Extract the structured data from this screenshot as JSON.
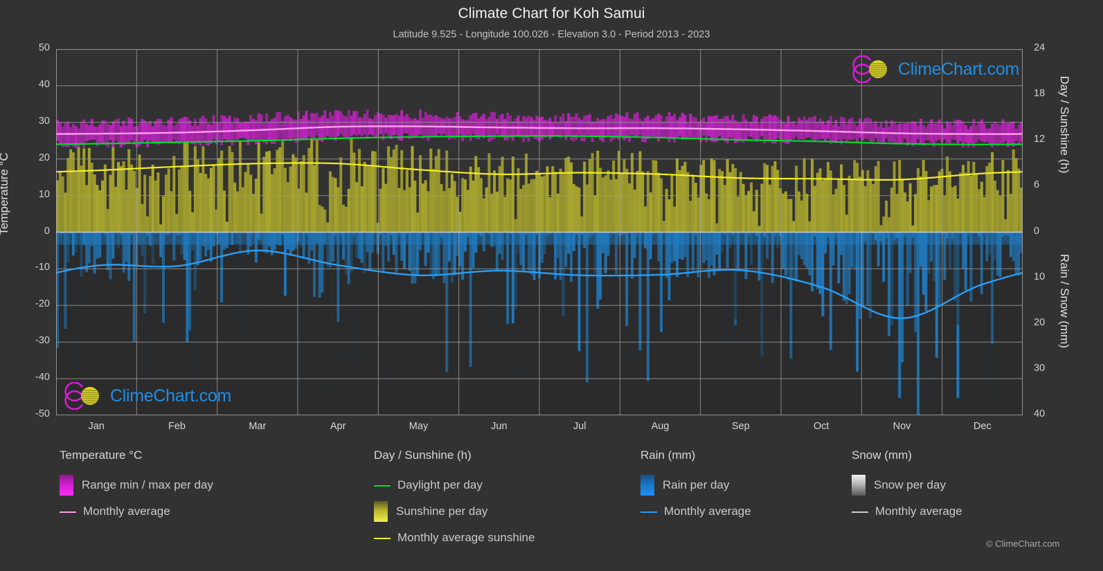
{
  "header": {
    "title": "Climate Chart for Koh Samui",
    "subtitle": "Latitude 9.525 - Longitude 100.026 - Elevation 3.0 - Period 2013 - 2023"
  },
  "branding": {
    "logo_text": "ClimeChart.com",
    "copyright": "© ClimeChart.com",
    "logo_arc_color": "#d81ad8",
    "logo_sphere_color": "#e8e22a",
    "logo_text_color": "#1f8fe8"
  },
  "axes": {
    "left": {
      "title": "Temperature °C",
      "ticks": [
        "50",
        "40",
        "30",
        "20",
        "10",
        "0",
        "-10",
        "-20",
        "-30",
        "-40",
        "-50"
      ],
      "min": -50,
      "max": 50,
      "step": 10
    },
    "right_top": {
      "title": "Day / Sunshine (h)",
      "ticks": [
        "24",
        "18",
        "12",
        "6",
        "0"
      ],
      "min": 0,
      "max": 24,
      "step": 6
    },
    "right_bottom": {
      "title": "Rain / Snow (mm)",
      "ticks": [
        "0",
        "10",
        "20",
        "30",
        "40"
      ],
      "min": 0,
      "max": 40,
      "step": 10
    },
    "x": {
      "ticks": [
        "Jan",
        "Feb",
        "Mar",
        "Apr",
        "May",
        "Jun",
        "Jul",
        "Aug",
        "Sep",
        "Oct",
        "Nov",
        "Dec"
      ]
    }
  },
  "legend": {
    "groups": [
      {
        "title": "Temperature °C",
        "items": [
          {
            "label": "Range min / max per day",
            "marker": "band",
            "color": "#ff2bff"
          },
          {
            "label": "Monthly average",
            "marker": "line",
            "color": "#ff9ff0"
          }
        ]
      },
      {
        "title": "Day / Sunshine (h)",
        "items": [
          {
            "label": "Daylight per day",
            "marker": "line",
            "color": "#00dd2a"
          },
          {
            "label": "Sunshine per day",
            "marker": "band",
            "color": "#e8e246"
          },
          {
            "label": "Monthly average sunshine",
            "marker": "line",
            "color": "#f5f020"
          }
        ]
      },
      {
        "title": "Rain (mm)",
        "items": [
          {
            "label": "Rain per day",
            "marker": "band",
            "color": "#1e90ff"
          },
          {
            "label": "Monthly average",
            "marker": "line",
            "color": "#2a9df4"
          }
        ]
      },
      {
        "title": "Snow (mm)",
        "items": [
          {
            "label": "Snow per day",
            "marker": "band",
            "color": "#dcdcdc"
          },
          {
            "label": "Monthly average",
            "marker": "line",
            "color": "#cccccc"
          }
        ]
      }
    ]
  },
  "chart_data": {
    "type": "area",
    "title": "Climate Chart for Koh Samui",
    "subtitle": "Latitude 9.525 - Longitude 100.026 - Elevation 3.0 - Period 2013 - 2023",
    "xlabel": "",
    "ylabel": "Temperature °C",
    "ylim": [
      -50,
      50
    ],
    "grid": true,
    "legend_position": "bottom",
    "categories": [
      "Jan",
      "Feb",
      "Mar",
      "Apr",
      "May",
      "Jun",
      "Jul",
      "Aug",
      "Sep",
      "Oct",
      "Nov",
      "Dec"
    ],
    "series": [
      {
        "name": "Monthly average temperature",
        "unit": "°C",
        "axis": "left",
        "color": "#ff9ff0",
        "values": [
          26.9,
          27.2,
          27.9,
          28.8,
          28.9,
          28.6,
          28.4,
          28.4,
          28.1,
          27.6,
          27.0,
          26.8
        ]
      },
      {
        "name": "Range min per day",
        "unit": "°C",
        "axis": "left",
        "color": "#c71fc7",
        "values": [
          24.2,
          24.4,
          25.0,
          25.8,
          26.0,
          25.8,
          25.6,
          25.6,
          25.3,
          25.0,
          24.5,
          24.2
        ]
      },
      {
        "name": "Range max per day",
        "unit": "°C",
        "axis": "left",
        "color": "#ff2bff",
        "values": [
          29.8,
          30.3,
          31.2,
          32.2,
          32.1,
          31.6,
          31.4,
          31.4,
          31.1,
          30.5,
          29.8,
          29.5
        ]
      },
      {
        "name": "Daylight per day",
        "unit": "h",
        "axis": "right_top",
        "color": "#00dd2a",
        "values": [
          11.6,
          11.8,
          12.0,
          12.3,
          12.5,
          12.6,
          12.6,
          12.4,
          12.1,
          11.9,
          11.6,
          11.5
        ]
      },
      {
        "name": "Monthly average sunshine",
        "unit": "h",
        "axis": "right_top",
        "color": "#f5f020",
        "values": [
          8.1,
          8.6,
          9.0,
          9.0,
          8.2,
          7.6,
          7.8,
          7.6,
          7.1,
          7.0,
          6.9,
          7.7
        ]
      },
      {
        "name": "Monthly average rain",
        "unit": "mm",
        "axis": "right_bottom",
        "color": "#2a9df4",
        "values": [
          7.3,
          7.4,
          4.0,
          7.2,
          9.4,
          8.4,
          9.4,
          9.3,
          8.3,
          12.0,
          18.8,
          11.4
        ]
      },
      {
        "name": "Monthly average snow",
        "unit": "mm",
        "axis": "right_bottom",
        "color": "#cccccc",
        "values": [
          0,
          0,
          0,
          0,
          0,
          0,
          0,
          0,
          0,
          0,
          0,
          0
        ]
      }
    ]
  }
}
